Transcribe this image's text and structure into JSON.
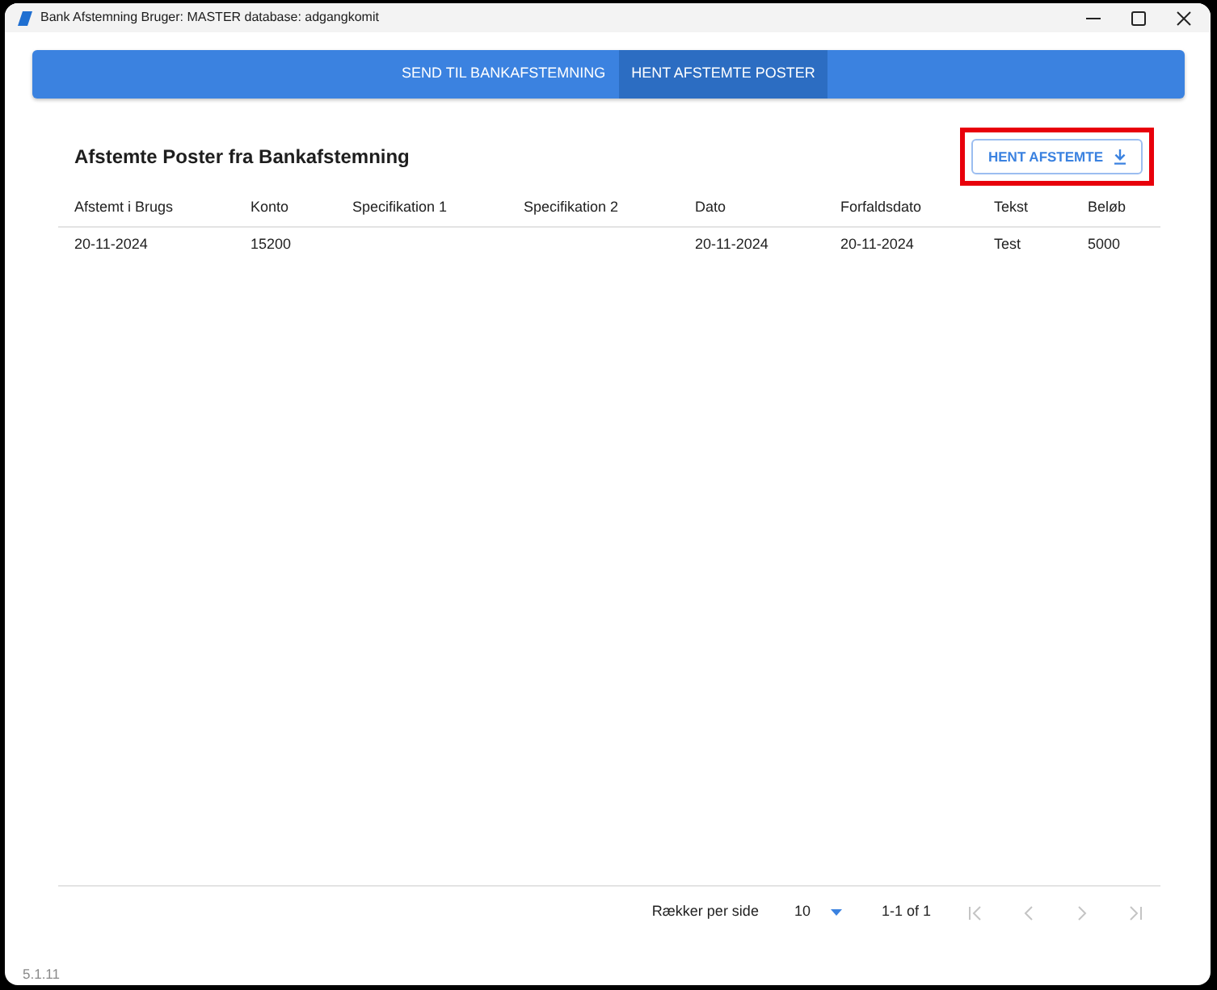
{
  "window": {
    "title": "Bank Afstemning Bruger: MASTER database: adgangkomit"
  },
  "tabs": [
    {
      "label": "SEND TIL BANKAFSTEMNING",
      "selected": false
    },
    {
      "label": "HENT AFSTEMTE POSTER",
      "selected": true
    }
  ],
  "section": {
    "title": "Afstemte Poster fra Bankafstemning",
    "button": {
      "label": "HENT AFSTEMTE",
      "highlighted": true
    }
  },
  "table": {
    "columns": [
      "Afstemt i Brugs",
      "Konto",
      "Specifikation 1",
      "Specifikation 2",
      "Dato",
      "Forfaldsdato",
      "Tekst",
      "Beløb"
    ],
    "rows": [
      [
        "20-11-2024",
        "15200",
        null,
        null,
        "20-11-2024",
        "20-11-2024",
        "Test",
        "5000"
      ]
    ]
  },
  "pagination": {
    "rows_per_page_label": "Rækker per side",
    "rows_per_page": "10",
    "range": "1-1 of 1",
    "nav_buttons": [
      {
        "kind": "first",
        "disabled": true
      },
      {
        "kind": "previous",
        "disabled": true
      },
      {
        "kind": "next",
        "disabled": true
      },
      {
        "kind": "last",
        "disabled": true
      }
    ]
  },
  "version": "5.1.11"
}
